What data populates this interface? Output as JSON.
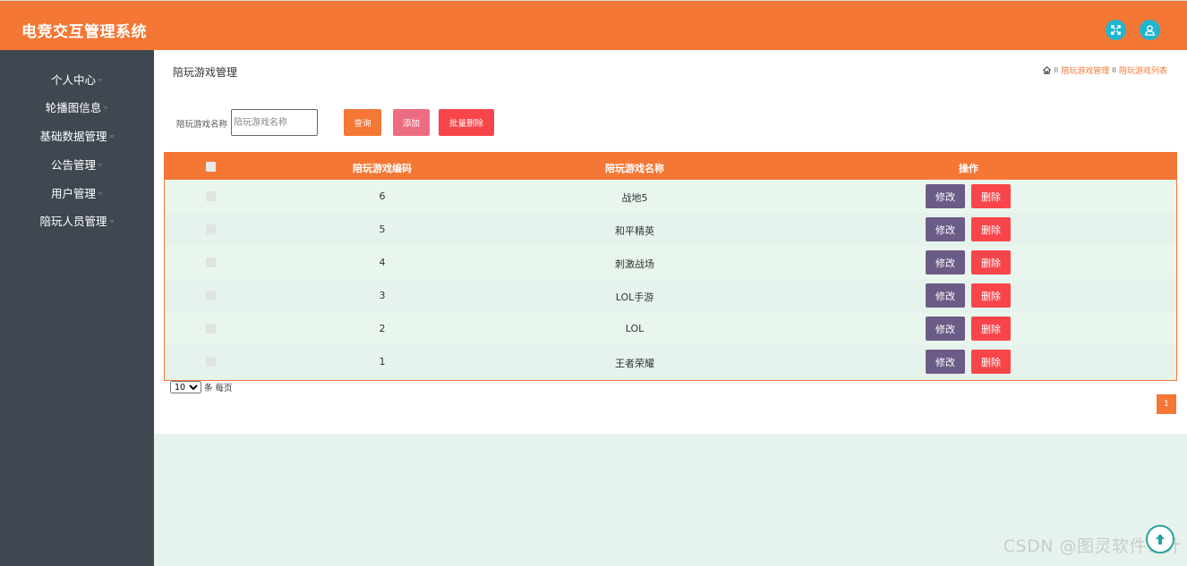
{
  "app": {
    "title": "电竞交互管理系统"
  },
  "header": {
    "icons": [
      "fullscreen-icon",
      "user-icon"
    ],
    "accent": "#f47735",
    "icon_bg": "#20b6cf"
  },
  "sidebar": {
    "items": [
      {
        "label": "个人中心"
      },
      {
        "label": "轮播图信息"
      },
      {
        "label": "基础数据管理"
      },
      {
        "label": "公告管理"
      },
      {
        "label": "用户管理"
      },
      {
        "label": "陪玩人员管理"
      }
    ]
  },
  "page": {
    "title": "陪玩游戏管理",
    "breadcrumb": [
      "陪玩游戏管理",
      "陪玩游戏列表"
    ],
    "breadcrumb_sep": "II"
  },
  "search": {
    "label": "陪玩游戏名称",
    "placeholder": "陪玩游戏名称",
    "value": ""
  },
  "toolbar": {
    "query_label": "查询",
    "add_label": "添加",
    "batch_delete_label": "批量删除"
  },
  "table": {
    "columns": [
      "陪玩游戏编码",
      "陪玩游戏名称",
      "操作"
    ],
    "rows": [
      {
        "code": "6",
        "name": "战地5",
        "edit": "修改",
        "delete": "删除"
      },
      {
        "code": "5",
        "name": "和平精英",
        "edit": "修改",
        "delete": "删除"
      },
      {
        "code": "4",
        "name": "刺激战场",
        "edit": "修改",
        "delete": "删除"
      },
      {
        "code": "3",
        "name": "LOL手游",
        "edit": "修改",
        "delete": "删除"
      },
      {
        "code": "2",
        "name": "LOL",
        "edit": "修改",
        "delete": "删除"
      },
      {
        "code": "1",
        "name": "王者荣耀",
        "edit": "修改",
        "delete": "删除"
      }
    ]
  },
  "pager": {
    "page_size": "10",
    "page_size_suffix": "条 每页",
    "current_page": "1"
  },
  "watermark": "CSDN @图灵软件设计"
}
